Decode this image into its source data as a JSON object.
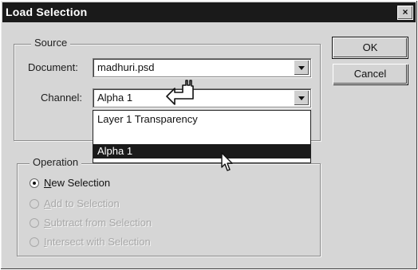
{
  "dialog": {
    "title": "Load Selection",
    "close_glyph": "×"
  },
  "source": {
    "group_title": "Source",
    "document_label": "Document:",
    "document_value": "madhuri.psd",
    "channel_label": "Channel:",
    "channel_value": "Alpha 1",
    "dropdown_options": [
      "Layer 1 Transparency",
      "Alpha 1"
    ],
    "dropdown_selected": "Alpha 1"
  },
  "operation": {
    "group_title": "Operation",
    "options": [
      {
        "label": "New Selection",
        "checked": true,
        "enabled": true
      },
      {
        "label": "Add to Selection",
        "checked": false,
        "enabled": false
      },
      {
        "label": "Subtract from Selection",
        "checked": false,
        "enabled": false
      },
      {
        "label": "Intersect with Selection",
        "checked": false,
        "enabled": false
      }
    ]
  },
  "buttons": {
    "ok_label": "OK",
    "cancel_label": "Cancel"
  },
  "cursors": [
    "pointing-hand-cursor-icon",
    "arrow-cursor-icon"
  ]
}
